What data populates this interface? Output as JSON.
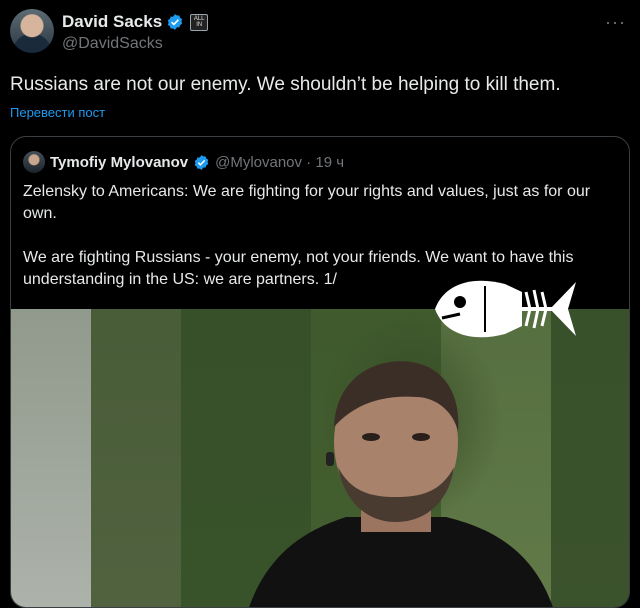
{
  "author": {
    "name": "David Sacks",
    "handle": "@DavidSacks",
    "badge_text": "ALL IN"
  },
  "menu_icon": "more-icon",
  "tweet": {
    "text": "Russians are not our enemy. We shouldn’t be helping to kill them.",
    "translate_label": "Перевести пост"
  },
  "quote": {
    "name": "Tymofiy Mylovanov",
    "meta": "@Mylovanov · 19 ч",
    "paragraph1": "Zelensky to Americans: We are fighting for your rights and values, just as for our own.",
    "paragraph2": "We are fighting Russians - your enemy, not your friends. We want to have this understanding in the US: we are partners. 1/"
  },
  "colors": {
    "background": "#000000",
    "text": "#e7e9ea",
    "muted": "#71767b",
    "accent": "#1d9bf0"
  }
}
